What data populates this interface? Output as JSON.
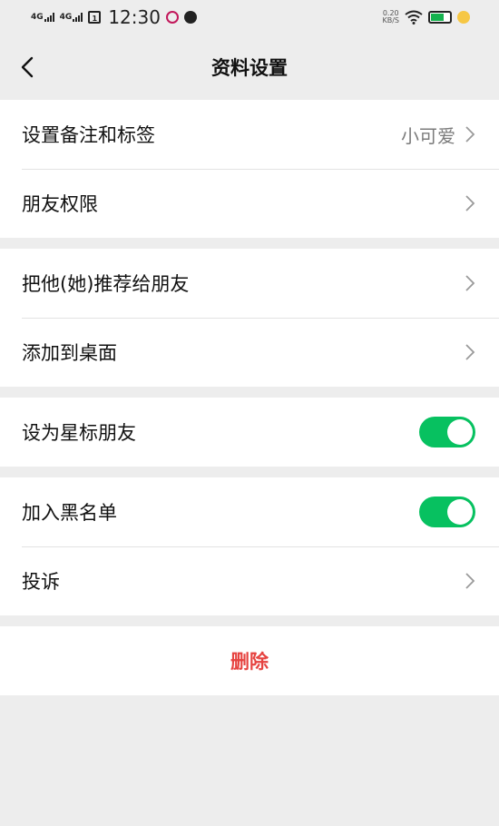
{
  "status": {
    "signal1": "4G",
    "signal2": "4G",
    "sim_badge": "1",
    "time": "12:30",
    "net_speed_top": "0.20",
    "net_speed_bottom": "KB/S"
  },
  "nav": {
    "title": "资料设置"
  },
  "groups": {
    "g1": {
      "remark": {
        "label": "设置备注和标签",
        "value": "小可爱"
      },
      "permissions": {
        "label": "朋友权限"
      }
    },
    "g2": {
      "recommend": {
        "label": "把他(她)推荐给朋友"
      },
      "desktop": {
        "label": "添加到桌面"
      }
    },
    "g3": {
      "star": {
        "label": "设为星标朋友",
        "on": true
      }
    },
    "g4": {
      "blacklist": {
        "label": "加入黑名单",
        "on": true
      },
      "report": {
        "label": "投诉"
      }
    },
    "g5": {
      "delete": {
        "label": "删除"
      }
    }
  },
  "colors": {
    "accent": "#07c160",
    "danger": "#e64340",
    "background": "#ededed"
  }
}
